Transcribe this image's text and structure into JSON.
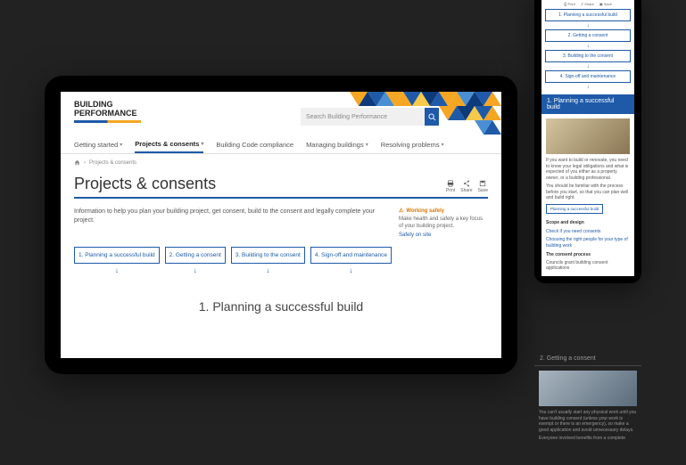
{
  "logo": {
    "line1": "BUILDING",
    "line2": "PERFORMANCE"
  },
  "search": {
    "placeholder": "Search Building Performance"
  },
  "nav": [
    {
      "label": "Getting started"
    },
    {
      "label": "Projects & consents",
      "active": true
    },
    {
      "label": "Building Code compliance"
    },
    {
      "label": "Managing buildings"
    },
    {
      "label": "Resolving problems"
    }
  ],
  "breadcrumb": "Projects & consents",
  "pageTitle": "Projects & consents",
  "actions": {
    "print": "Print",
    "share": "Share",
    "save": "Save"
  },
  "intro": "Information to help you plan your building project, get consent, build to the consent and legally complete your project.",
  "safety": {
    "title": "Working safely",
    "text": "Make health and safety a key focus of your building project.",
    "link": "Safety on site"
  },
  "steps": [
    "1. Planning a successful build",
    "2. Getting a consent",
    "3. Building to the consent",
    "4. Sign-off and maintenance"
  ],
  "section1Title": "1. Planning a successful build",
  "mobile": {
    "steps": [
      "1. Planning a successful build",
      "2. Getting a consent",
      "3. Building to the consent",
      "4. Sign-off and maintenance"
    ],
    "sec1": {
      "title": "1. Planning a successful build",
      "body": "If you want to build or renovate, you need to know your legal obligations and what is expected of you either as a property owner, or a building professional.",
      "body2": "You should be familiar with the process before you start, so that you can plan well and build right.",
      "btn": "Planning a successful build",
      "sub1": "Scope and design",
      "link1": "Check if you need consents",
      "link2": "Choosing the right people for your type of building work",
      "sub2": "The consent process",
      "body3": "Councils grant building consent applications"
    },
    "sec2": {
      "title": "2. Getting a consent",
      "body": "You can't usually start any physical work until you have building consent (unless your work is exempt or there is an emergency), so make a good application and avoid unnecessary delays.",
      "body2": "Everyone involved benefits from a complete"
    }
  }
}
